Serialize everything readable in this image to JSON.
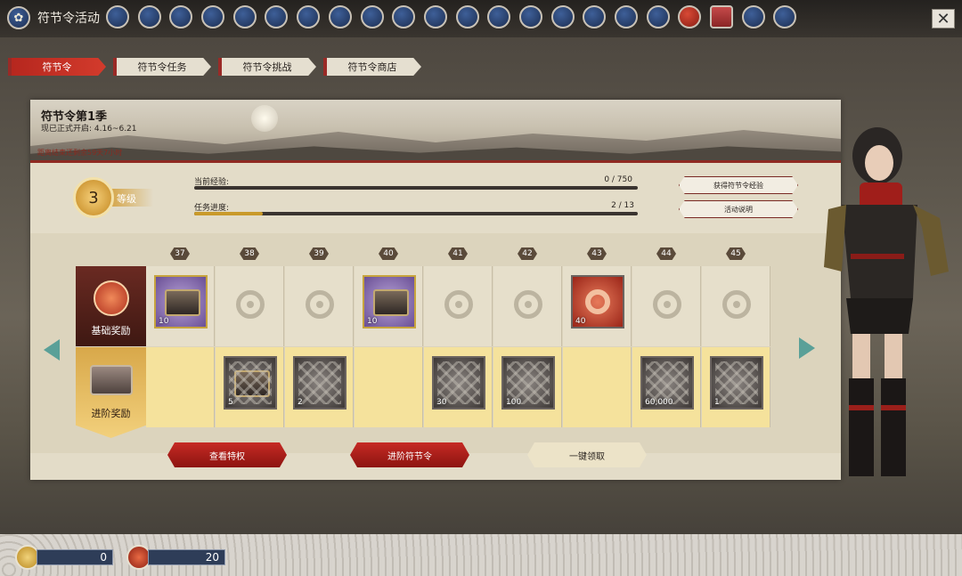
{
  "topbar": {
    "title": "符节令活动",
    "close_label": "✕",
    "icon_names": [
      "ui-icon-1",
      "ui-icon-2",
      "ui-icon-3",
      "ui-icon-4",
      "ui-icon-5",
      "ui-icon-6",
      "ui-icon-7",
      "ui-icon-8",
      "ui-icon-9",
      "ui-icon-10",
      "ui-icon-11",
      "ui-icon-12",
      "ui-icon-13",
      "ui-icon-14",
      "ui-icon-15",
      "ui-icon-16",
      "ui-icon-17",
      "ui-icon-18",
      "ui-icon-19",
      "ui-icon-20",
      "ui-icon-21",
      "ui-icon-22"
    ]
  },
  "tabs": [
    {
      "label": "符节令",
      "active": true
    },
    {
      "label": "符节令任务",
      "active": false
    },
    {
      "label": "符节令挑战",
      "active": false
    },
    {
      "label": "符节令商店",
      "active": false
    }
  ],
  "season": {
    "title": "符节令第1季",
    "open_text": "现已正式开启: 4.16~6.21",
    "time_left": "距离结束还剩余59天7小时"
  },
  "level": {
    "value": "3",
    "label": "等级"
  },
  "progress": {
    "exp_label": "当前经验:",
    "exp_value": "0 / 750",
    "exp_fraction": 0,
    "task_label": "任务进度:",
    "task_value": "2 / 13",
    "task_fraction": 0.1538
  },
  "side_buttons": {
    "get_exp": "获得符节令经验",
    "help": "活动说明"
  },
  "levels": [
    "37",
    "38",
    "39",
    "40",
    "41",
    "42",
    "43",
    "44",
    "45"
  ],
  "rows": {
    "basic_label": "基础奖励",
    "advanced_label": "进阶奖励"
  },
  "basic_rewards": [
    {
      "type": "chest-purple",
      "qty": "10"
    },
    {
      "type": "empty",
      "qty": ""
    },
    {
      "type": "empty",
      "qty": ""
    },
    {
      "type": "chest-purple",
      "qty": "10"
    },
    {
      "type": "empty",
      "qty": ""
    },
    {
      "type": "empty",
      "qty": ""
    },
    {
      "type": "knot-token",
      "qty": "40"
    },
    {
      "type": "empty",
      "qty": ""
    },
    {
      "type": "empty",
      "qty": ""
    }
  ],
  "advanced_rewards": [
    {
      "type": "none",
      "qty": ""
    },
    {
      "type": "locked-chest",
      "qty": "5"
    },
    {
      "type": "locked-item",
      "qty": "2"
    },
    {
      "type": "none",
      "qty": ""
    },
    {
      "type": "locked-item",
      "qty": "30"
    },
    {
      "type": "locked-item",
      "qty": "100"
    },
    {
      "type": "none",
      "qty": ""
    },
    {
      "type": "locked-item",
      "qty": "60,000"
    },
    {
      "type": "locked-item",
      "qty": "1"
    }
  ],
  "actions": {
    "privileges": "查看特权",
    "advance": "进阶符节令",
    "claim_all": "一键领取"
  },
  "currency": {
    "gold": "0",
    "knot": "20"
  }
}
